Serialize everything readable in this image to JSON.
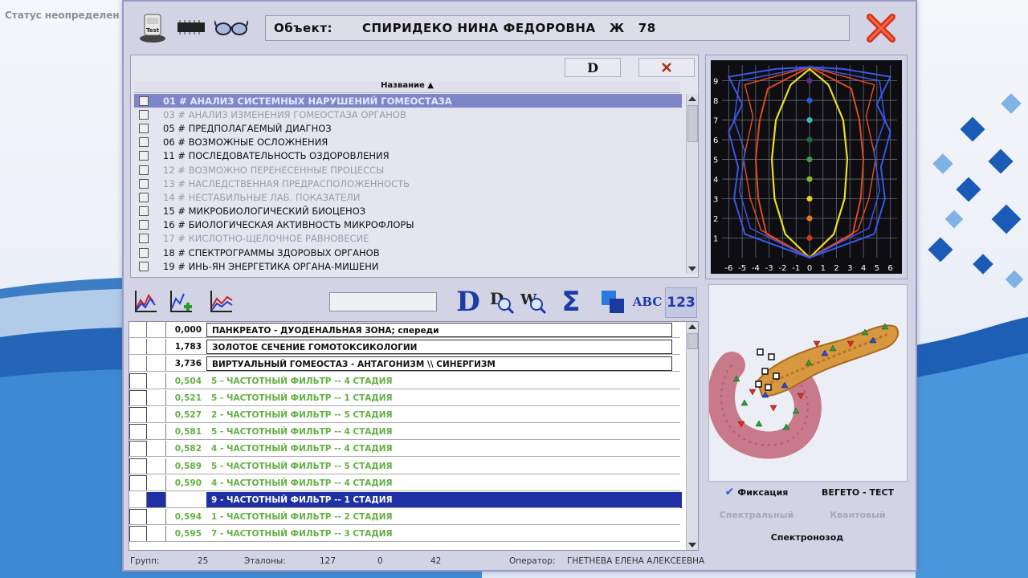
{
  "desktop": {
    "status_label": "Статус неопределен"
  },
  "window": {
    "object_label": "Объект:",
    "object_value": "СПИРИДЕКО НИНА ФЕДОРОВНА   Ж   78",
    "icons": [
      "test-device-icon",
      "chip-icon",
      "glasses-icon"
    ],
    "close_icon": "red-x-close-icon"
  },
  "top_panel": {
    "btn_d": "D",
    "btn_clear_icon": "cross-icon",
    "column_header": "Название ▲",
    "items": [
      {
        "label": "01 # АНАЛИЗ СИСТЕМНЫХ НАРУШЕНИЙ ГОМЕОСТАЗА",
        "state": "selected"
      },
      {
        "label": "03 # АНАЛИЗ ИЗМЕНЕНИЯ ГОМЕОСТАЗА ОРГАНОВ",
        "state": "disabled"
      },
      {
        "label": "05 # ПРЕДПОЛАГАЕМЫЙ  ДИАГНОЗ",
        "state": "normal"
      },
      {
        "label": "06 # ВОЗМОЖНЫЕ  ОСЛОЖНЕНИЯ",
        "state": "normal"
      },
      {
        "label": "11 # ПОСЛЕДОВАТЕЛЬНОСТЬ ОЗДОРОВЛЕНИЯ",
        "state": "normal"
      },
      {
        "label": "12 # ВОЗМОЖНО ПЕРЕНЕСЕННЫЕ ПРОЦЕССЫ",
        "state": "disabled"
      },
      {
        "label": "13 # НАСЛЕДСТВЕННАЯ  ПРЕДРАСПОЛОЖЕННОСТЬ",
        "state": "disabled"
      },
      {
        "label": "14 # НЕСТАБИЛЬНЫЕ  ЛАБ. ПОКАЗАТЕЛИ",
        "state": "disabled"
      },
      {
        "label": "15 # МИКРОБИОЛОГИЧЕСКИЙ  БИОЦЕНОЗ",
        "state": "normal"
      },
      {
        "label": "16 # БИОЛОГИЧЕСКАЯ АКТИВНОСТЬ МИКРОФЛОРЫ",
        "state": "normal"
      },
      {
        "label": "17 # КИСЛОТНО-ЩЕЛОЧНОЕ  РАВНОВЕСИЕ",
        "state": "disabled"
      },
      {
        "label": "18 # СПЕКТРОГРАММЫ  ЗДОРОВЫХ ОРГАНОВ",
        "state": "normal"
      },
      {
        "label": "19 # ИНЬ-ЯН ЭНЕРГЕТИКА   ОРГАНА-МИШЕНИ",
        "state": "normal"
      }
    ]
  },
  "chart": {
    "y_ticks": [
      "1",
      "2",
      "3",
      "4",
      "5",
      "6",
      "7",
      "8",
      "9"
    ],
    "x_ticks": [
      "-6",
      "-5",
      "-4",
      "-3",
      "-2",
      "-1",
      "0",
      "1",
      "2",
      "3",
      "4",
      "5",
      "6"
    ],
    "dot_colors": [
      "#d03a1a",
      "#e07a20",
      "#e6d020",
      "#8ab820",
      "#3aa04a",
      "#1f6a40",
      "#3abcb0",
      "#2a58d8",
      "#5a2a90"
    ],
    "series_colors": {
      "inner": "#e8e020",
      "middle": "#e04a20",
      "outer": "#3a58e8"
    }
  },
  "toolbar": {
    "tools": [
      "chart-diagnose-icon",
      "chart-add-icon",
      "chart-compare-icon",
      "d-letter-icon",
      "d-search-icon",
      "w-search-icon",
      "sigma-icon",
      "squares-icon",
      "abc-icon",
      "123-icon"
    ],
    "labels": {
      "d": "D",
      "sigma": "Σ",
      "abc": "ABC",
      "num": "123"
    },
    "search_value": ""
  },
  "table": {
    "rows": [
      {
        "value": "0,000",
        "label": "ПАНКРЕАТО - ДУОДЕНАЛЬНАЯ  ЗОНА;  спереди",
        "style": "boxed"
      },
      {
        "value": "1,783",
        "label": "ЗОЛОТОЕ СЕЧЕНИЕ ГОМОТОКСИКОЛОГИИ",
        "style": "boxed"
      },
      {
        "value": "3,736",
        "label": "ВИРТУАЛЬНЫЙ ГОМЕОСТАЗ - АНТАГОНИЗМ \\\\ СИНЕРГИЗМ",
        "style": "boxed"
      },
      {
        "value": "0,504",
        "label": "5 - ЧАСТОТНЫЙ ФИЛЬТР -- 4 СТАДИЯ",
        "style": "green"
      },
      {
        "value": "0,521",
        "label": "5 - ЧАСТОТНЫЙ ФИЛЬТР -- 1 СТАДИЯ",
        "style": "green"
      },
      {
        "value": "0,527",
        "label": "2 - ЧАСТОТНЫЙ ФИЛЬТР -- 5 СТАДИЯ",
        "style": "green"
      },
      {
        "value": "0,581",
        "label": "5 - ЧАСТОТНЫЙ ФИЛЬТР -- 4 СТАДИЯ",
        "style": "green"
      },
      {
        "value": "0,582",
        "label": "4 - ЧАСТОТНЫЙ ФИЛЬТР -- 4 СТАДИЯ",
        "style": "green"
      },
      {
        "value": "0,589",
        "label": "5 - ЧАСТОТНЫЙ ФИЛЬТР -- 5 СТАДИЯ",
        "style": "green"
      },
      {
        "value": "0,590",
        "label": "4 - ЧАСТОТНЫЙ ФИЛЬТР -- 4 СТАДИЯ",
        "style": "green"
      },
      {
        "value": "",
        "label": "9 - ЧАСТОТНЫЙ ФИЛЬТР -- 1 СТАДИЯ",
        "style": "highlight"
      },
      {
        "value": "0,594",
        "label": "1 - ЧАСТОТНЫЙ ФИЛЬТР -- 2 СТАДИЯ",
        "style": "green"
      },
      {
        "value": "0,595",
        "label": "7 - ЧАСТОТНЫЙ ФИЛЬТР -- 3 СТАДИЯ",
        "style": "green"
      }
    ]
  },
  "organ_panel": {
    "image_icon": "pancreas-duodenum-organ-icon"
  },
  "modes": {
    "fixation": "Фиксация",
    "fixation_checked": true,
    "vegeto": "ВЕГЕТО - ТЕСТ",
    "spectral": "Спектральный",
    "quantum": "Квантовый",
    "spectronozod": "Спектронозод"
  },
  "statusbar": {
    "groups_label": "Групп:",
    "groups_value": "25",
    "etalons_label": "Эталоны:",
    "etalons_value": "127",
    "val_a": "0",
    "val_b": "42",
    "operator_label": "Оператор:",
    "operator_value": "ГНЕТНЕВА ЕЛЕНА АЛЕКСЕЕВНА"
  }
}
